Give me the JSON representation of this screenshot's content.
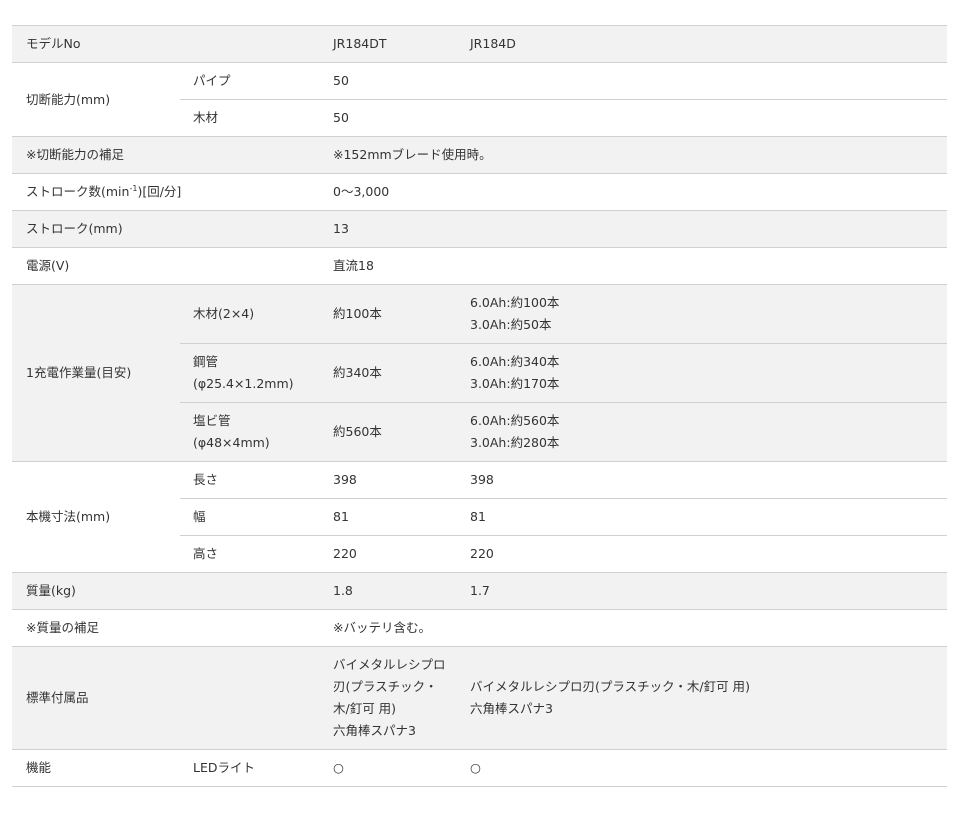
{
  "spec_table": {
    "groups": [
      {
        "label": "モデルNo",
        "shade": true,
        "rows": [
          {
            "h": 37,
            "sub": "",
            "col1": "JR184DT",
            "col2": "JR184D"
          }
        ]
      },
      {
        "label": "切断能力(mm)",
        "shade": false,
        "rows": [
          {
            "h": 37,
            "sub": "パイプ",
            "col1": "50",
            "col2": ""
          },
          {
            "h": 37,
            "sub": "木材",
            "col1": "50",
            "col2": ""
          }
        ]
      },
      {
        "label": "※切断能力の補足",
        "shade": true,
        "rows": [
          {
            "h": 37,
            "sub": "",
            "span": "※152mmブレード使用時。"
          }
        ]
      },
      {
        "label": "ストローク数(min-1)[回/分]",
        "shade": false,
        "rows": [
          {
            "h": 37,
            "sub": "",
            "col1": "0〜3,000",
            "col2": ""
          }
        ]
      },
      {
        "label": "ストローク(mm)",
        "shade": true,
        "rows": [
          {
            "h": 37,
            "sub": "",
            "col1": "13",
            "col2": ""
          }
        ]
      },
      {
        "label": "電源(V)",
        "shade": false,
        "rows": [
          {
            "h": 37,
            "sub": "",
            "col1": "直流18",
            "col2": ""
          }
        ]
      },
      {
        "label": "1充電作業量(目安)",
        "shade": true,
        "rows": [
          {
            "h": 59,
            "sub": "木材(2×4)",
            "col1": "約100本",
            "col2": "6.0Ah:約100本\n3.0Ah:約50本"
          },
          {
            "h": 59,
            "sub": "鋼管\n(φ25.4×1.2mm)",
            "col1": "約340本",
            "col2": "6.0Ah:約340本\n3.0Ah:約170本"
          },
          {
            "h": 59,
            "sub": "塩ビ管\n(φ48×4mm)",
            "col1": "約560本",
            "col2": "6.0Ah:約560本\n3.0Ah:約280本"
          }
        ]
      },
      {
        "label": "本機寸法(mm)",
        "shade": false,
        "rows": [
          {
            "h": 37,
            "sub": "長さ",
            "col1": "398",
            "col2": "398"
          },
          {
            "h": 37,
            "sub": "幅",
            "col1": "81",
            "col2": "81"
          },
          {
            "h": 37,
            "sub": "高さ",
            "col1": "220",
            "col2": "220"
          }
        ]
      },
      {
        "label": "質量(kg)",
        "shade": true,
        "rows": [
          {
            "h": 37,
            "sub": "",
            "col1": "1.8",
            "col2": "1.7"
          }
        ]
      },
      {
        "label": "※質量の補足",
        "shade": false,
        "rows": [
          {
            "h": 37,
            "sub": "",
            "span": "※バッテリ含む。"
          }
        ]
      },
      {
        "label": "標準付属品",
        "shade": true,
        "rows": [
          {
            "h": 103,
            "sub": "",
            "col1": "バイメタルレシプロ\n刃(プラスチック・\n木/釘可 用)\n六角棒スパナ3",
            "col2": "バイメタルレシプロ刃(プラスチック・木/釘可 用)\n六角棒スパナ3"
          }
        ]
      },
      {
        "label": "機能",
        "shade": false,
        "rows": [
          {
            "h": 37,
            "sub": "LEDライト",
            "col1": "○",
            "col2": "○"
          }
        ]
      }
    ]
  }
}
